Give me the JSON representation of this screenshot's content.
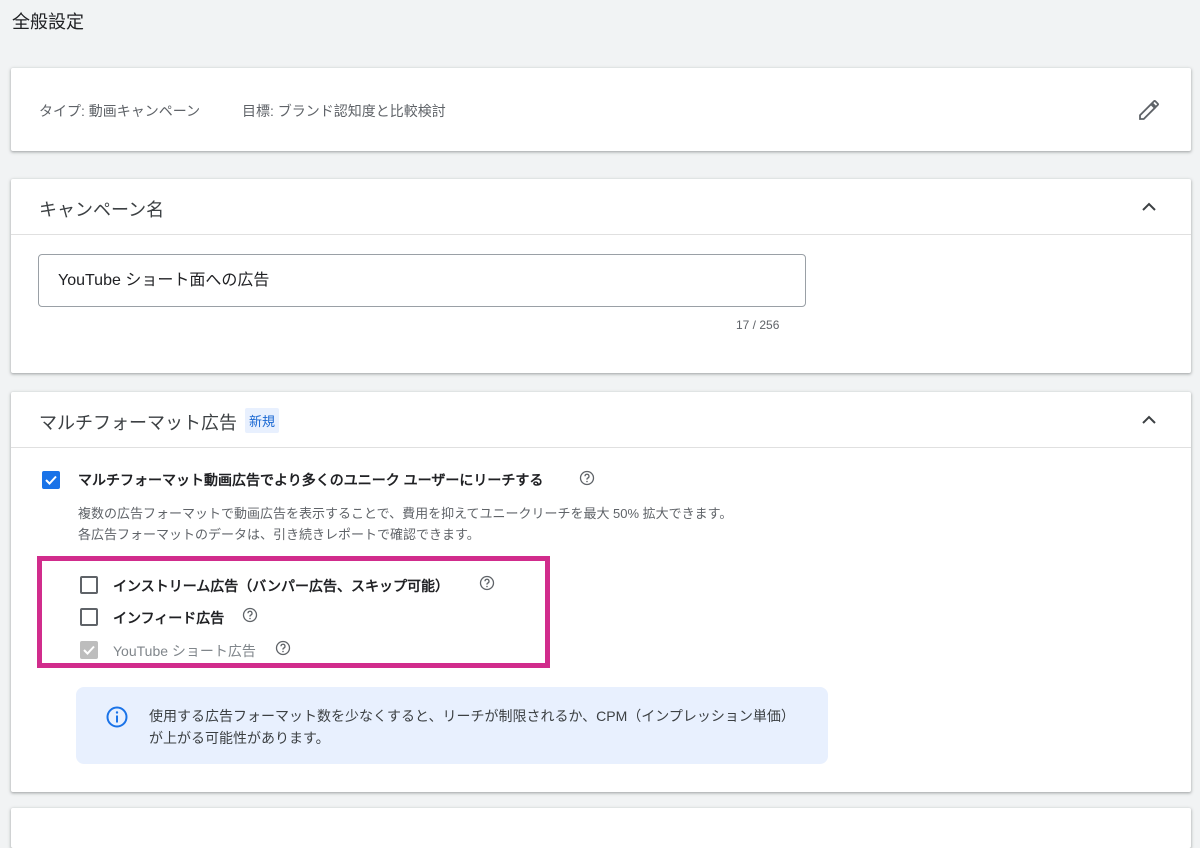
{
  "page": {
    "title": "全般設定"
  },
  "summary": {
    "type": "タイプ: 動画キャンペーン",
    "goal": "目標: ブランド認知度と比較検討"
  },
  "campaign_name": {
    "title": "キャンペーン名",
    "value": "YouTube ショート面への広告",
    "counter": "17 / 256"
  },
  "multiformat": {
    "title": "マルチフォーマット広告",
    "badge": "新規",
    "main_checkbox_label": "マルチフォーマット動画広告でより多くのユニーク ユーザーにリーチする",
    "main_checked": true,
    "desc_line1": "複数の広告フォーマットで動画広告を表示することで、費用を抑えてユニークリーチを最大 50% 拡大できます。",
    "desc_line2": "各広告フォーマットのデータは、引き続きレポートで確認できます。",
    "options": [
      {
        "label": "インストリーム広告（バンパー広告、スキップ可能）",
        "checked": false,
        "disabled": false
      },
      {
        "label": "インフィード広告",
        "checked": false,
        "disabled": false
      },
      {
        "label": "YouTube ショート広告",
        "checked": true,
        "disabled": true
      }
    ],
    "info_text": "使用する広告フォーマット数を少なくすると、リーチが制限されるか、CPM（インプレッション単価）が上がる可能性があります。"
  },
  "colors": {
    "accent": "#1a73e8",
    "highlight": "#d12c8c",
    "info_bg": "#e8f0fe"
  }
}
